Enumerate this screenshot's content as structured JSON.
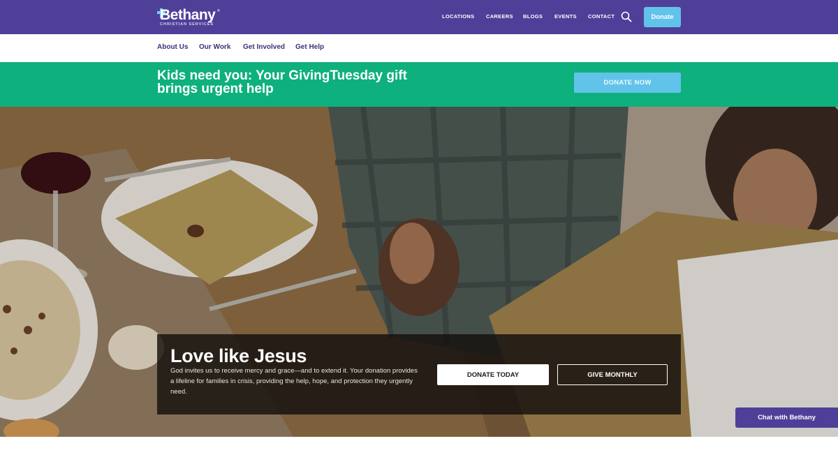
{
  "logo": {
    "name": "Bethany",
    "subtitle": "CHRISTIAN SERVICES",
    "tm": "®"
  },
  "topnav": {
    "items": [
      "LOCATIONS",
      "CAREERS",
      "BLOGS",
      "EVENTS",
      "CONTACT"
    ],
    "donate_label": "Donate"
  },
  "subnav": {
    "items": [
      "About Us",
      "Our Work",
      "Get Involved",
      "Get Help"
    ]
  },
  "banner": {
    "title": "Kids need you: Your GivingTuesday gift brings urgent help",
    "button_label": "DONATE NOW"
  },
  "hero": {
    "title": "Love like Jesus",
    "body": "God invites us to receive mercy and grace—and to extend it. Your donation provides a lifeline for families in crisis, providing the help, hope, and protection they urgently need.",
    "primary_button": "DONATE TODAY",
    "secondary_button": "GIVE MONTHLY"
  },
  "chat": {
    "label": "Chat with Bethany"
  },
  "colors": {
    "brand_purple": "#4f3f99",
    "banner_green": "#0eb07e",
    "accent_blue": "#62c3ea"
  },
  "icons": {
    "search": "search-icon"
  }
}
